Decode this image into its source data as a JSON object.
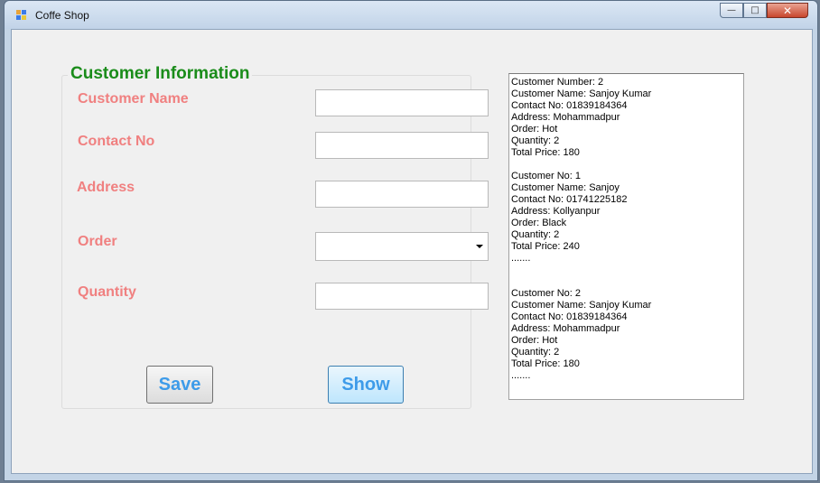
{
  "window": {
    "title": "Coffe Shop",
    "buttons": {
      "minimize": "—",
      "maximize": "□",
      "close": "✕"
    }
  },
  "form": {
    "group_title": "Customer Information",
    "labels": {
      "name": "Customer Name",
      "contact": "Contact No",
      "address": "Address",
      "order": "Order",
      "quantity": "Quantity"
    },
    "values": {
      "name": "",
      "contact": "",
      "address": "",
      "order": "",
      "quantity": ""
    },
    "buttons": {
      "save": "Save",
      "show": "Show"
    }
  },
  "output": {
    "lines": [
      "Customer Number: 2",
      "Customer Name: Sanjoy Kumar",
      "Contact No: 01839184364",
      "Address: Mohammadpur",
      "Order: Hot",
      "Quantity: 2",
      "Total Price: 180",
      "",
      "Customer No: 1",
      "Customer Name: Sanjoy",
      "Contact No: 01741225182",
      "Address: Kollyanpur",
      "Order: Black",
      "Quantity: 2",
      "Total Price: 240",
      ".......",
      "",
      "",
      "Customer No: 2",
      "Customer Name: Sanjoy Kumar",
      "Contact No: 01839184364",
      "Address: Mohammadpur",
      "Order: Hot",
      "Quantity: 2",
      "Total Price: 180",
      "......."
    ]
  },
  "colors": {
    "group_title": "#1a8c1a",
    "label": "#f08080",
    "button_text": "#3d9be9"
  }
}
